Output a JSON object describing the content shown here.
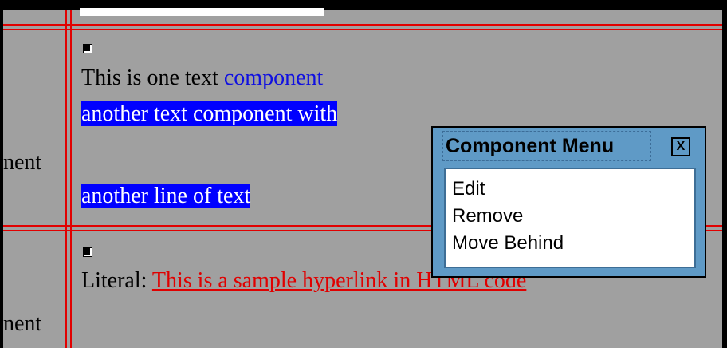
{
  "rows": [
    {
      "label": "nent",
      "lines": [
        {
          "plain": "This is one text ",
          "highlight": "component"
        },
        {
          "selected": "another text component with"
        },
        {
          "selected": "another line of text"
        }
      ]
    },
    {
      "label": "nent",
      "literal_label": "Literal: ",
      "hyperlink": "This is a sample hyperlink in HTML code"
    }
  ],
  "component_menu": {
    "title": "Component Menu",
    "close_label": "X",
    "items": [
      "Edit",
      "Remove",
      "Move Behind"
    ]
  },
  "colors": {
    "background": "#a0a0a0",
    "grid_line": "#e10000",
    "selection": "#0000ff",
    "text_highlight": "#1010e0",
    "hyperlink": "#e00000",
    "menu_frame": "#5f9ac6"
  }
}
